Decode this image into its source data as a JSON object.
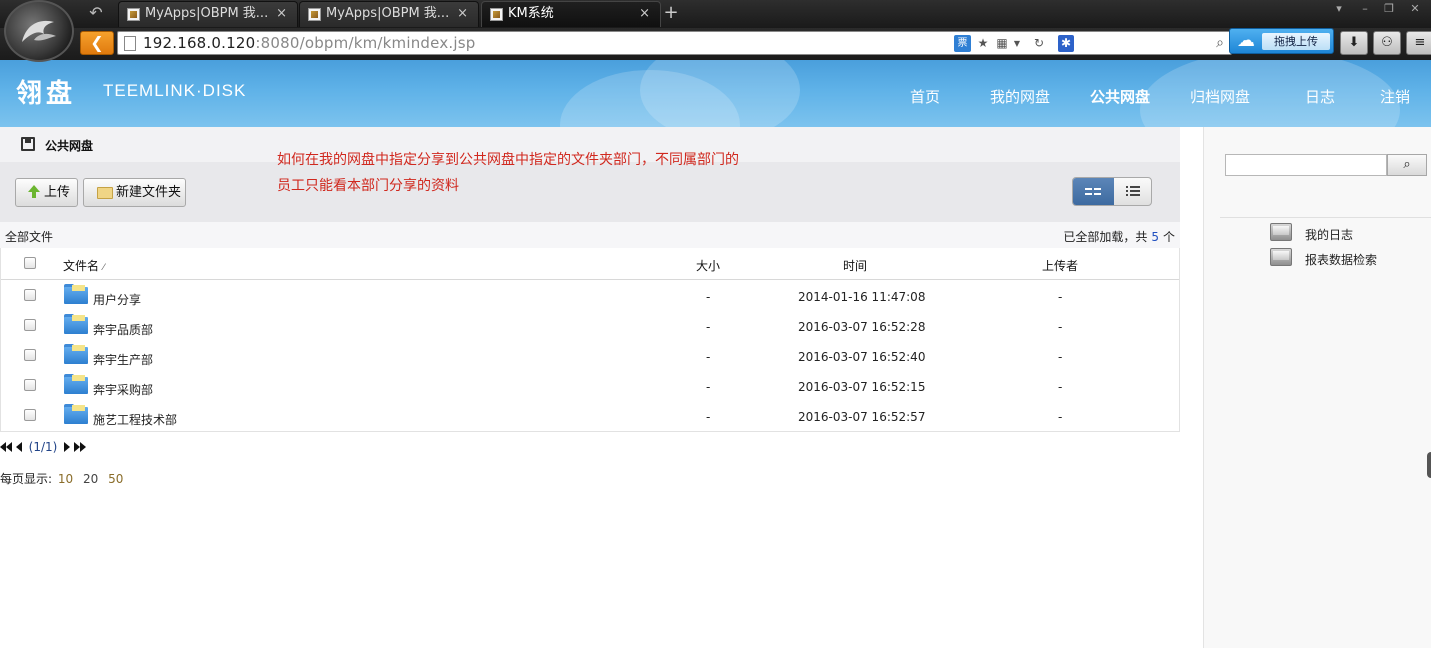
{
  "browser": {
    "tabs": [
      {
        "title": "MyApps|OBPM 我...",
        "active": false
      },
      {
        "title": "MyApps|OBPM 我...",
        "active": false
      },
      {
        "title": "KM系统",
        "active": true
      }
    ],
    "url_host": "192.168.0.120",
    "url_rest": ":8080/obpm/km/kmindex.jsp",
    "ticket_icon_label": "票",
    "cloud_upload_label": "拖拽上传"
  },
  "header": {
    "logo_cn": "翎盘",
    "logo_en": "TEEMLINK·DISK",
    "nav": [
      {
        "label": "首页",
        "active": false
      },
      {
        "label": "我的网盘",
        "active": false
      },
      {
        "label": "公共网盘",
        "active": true
      },
      {
        "label": "归档网盘",
        "active": false
      },
      {
        "label": "日志",
        "active": false
      },
      {
        "label": "注销",
        "active": false
      }
    ]
  },
  "main": {
    "title": "公共网盘",
    "upload_label": "上传",
    "new_folder_label": "新建文件夹",
    "annotation": "如何在我的网盘中指定分享到公共网盘中指定的文件夹部门，不同属部门的\n员工只能看本部门分享的资料",
    "all_files_label": "全部文件",
    "loaded_prefix": "已全部加载，共",
    "loaded_count": "5",
    "loaded_suffix": "个",
    "columns": {
      "name": "文件名",
      "size": "大小",
      "time": "时间",
      "uploader": "上传者"
    },
    "rows": [
      {
        "name": "用户分享",
        "size": "-",
        "time": "2014-01-16 11:47:08",
        "uploader": "-"
      },
      {
        "name": "奔宇品质部",
        "size": "-",
        "time": "2016-03-07 16:52:28",
        "uploader": "-"
      },
      {
        "name": "奔宇生产部",
        "size": "-",
        "time": "2016-03-07 16:52:40",
        "uploader": "-"
      },
      {
        "name": "奔宇采购部",
        "size": "-",
        "time": "2016-03-07 16:52:15",
        "uploader": "-"
      },
      {
        "name": "施艺工程技术部",
        "size": "-",
        "time": "2016-03-07 16:52:57",
        "uploader": "-"
      }
    ],
    "pager_text": "(1/1)",
    "per_page_label": "每页显示:",
    "per_page_options": [
      "10",
      "20",
      "50"
    ],
    "per_page_selected": "20"
  },
  "right_panel": {
    "items": [
      {
        "label": "我的日志"
      },
      {
        "label": "报表数据检索"
      }
    ]
  }
}
